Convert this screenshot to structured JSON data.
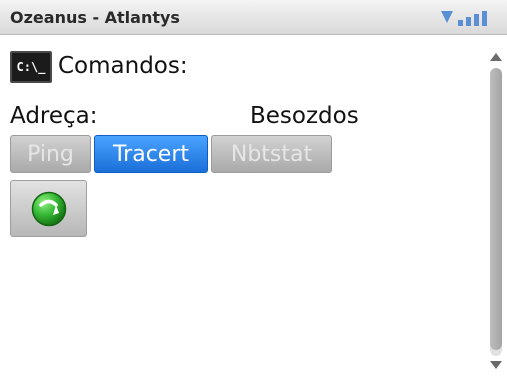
{
  "window": {
    "title": "Ozeanus - Atlantys",
    "signal_icon": "signal-strength-icon"
  },
  "commands": {
    "icon_text": "C:\\_",
    "label": "Comandos:"
  },
  "address": {
    "label": "Adreça:",
    "value": "Besozdos"
  },
  "tabs": [
    {
      "label": "Ping",
      "active": false
    },
    {
      "label": "Tracert",
      "active": true
    },
    {
      "label": "Nbtstat",
      "active": false
    }
  ],
  "actions": {
    "go_icon": "refresh-arrow-icon"
  },
  "scrollbar": {
    "thumb_position": 0,
    "up_icon": "scroll-up-icon",
    "down_icon": "scroll-down-icon"
  },
  "colors": {
    "active_tab": "#1a6fd8",
    "inactive_tab": "#a9a9a9",
    "go_button_green": "#2fa52f"
  }
}
